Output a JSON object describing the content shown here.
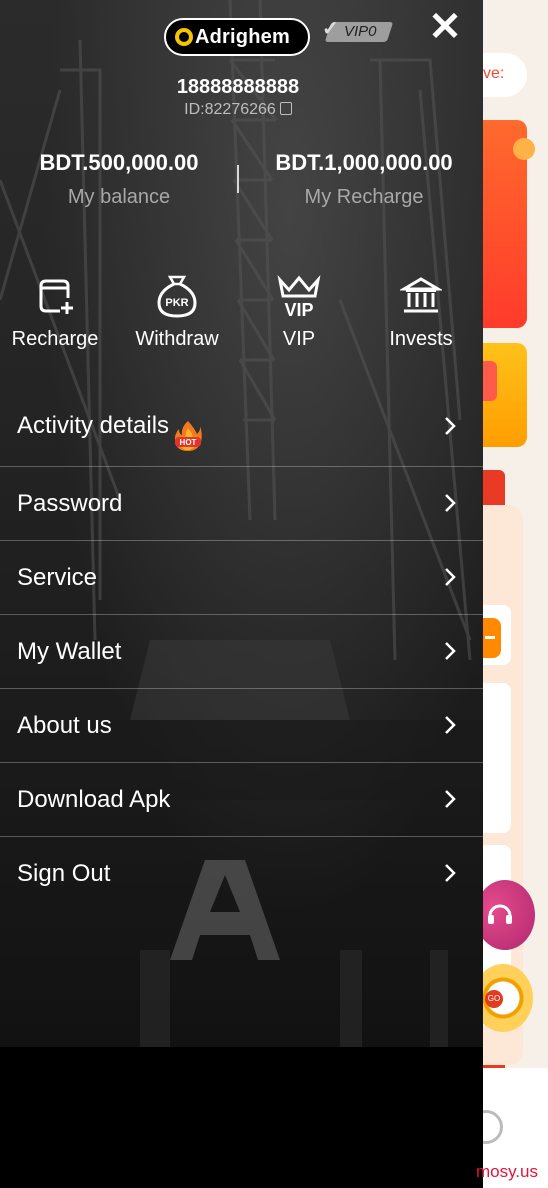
{
  "header": {
    "logo_text": "Adrighem",
    "vip_level": "VIP0",
    "close_icon": "close-icon"
  },
  "user": {
    "phone": "18888888888",
    "id_text": "ID:82276266"
  },
  "balances": {
    "balance_amount": "BDT.500,000.00",
    "balance_label": "My balance",
    "recharge_amount": "BDT.1,000,000.00",
    "recharge_label": "My Recharge"
  },
  "quick_actions": [
    {
      "label": "Recharge",
      "icon": "wallet-plus-icon"
    },
    {
      "label": "Withdraw",
      "icon": "money-bag-pkr-icon",
      "icon_text": "PKR"
    },
    {
      "label": "VIP",
      "icon": "vip-crown-icon",
      "icon_text": "VIP"
    },
    {
      "label": "Invests",
      "icon": "bank-icon"
    }
  ],
  "menu": [
    {
      "label": "Activity details",
      "badge": "HOT"
    },
    {
      "label": "Password"
    },
    {
      "label": "Service"
    },
    {
      "label": "My Wallet"
    },
    {
      "label": "About us"
    },
    {
      "label": "Download Apk"
    },
    {
      "label": "Sign Out"
    }
  ],
  "background_page": {
    "search_partial": "ve:",
    "wheel_text": "GO"
  },
  "watermark": "mosy.us",
  "colors": {
    "accent_gold": "#f5c400",
    "hot_badge": "#e2342a",
    "peek_orange": "#ff6a2d"
  }
}
